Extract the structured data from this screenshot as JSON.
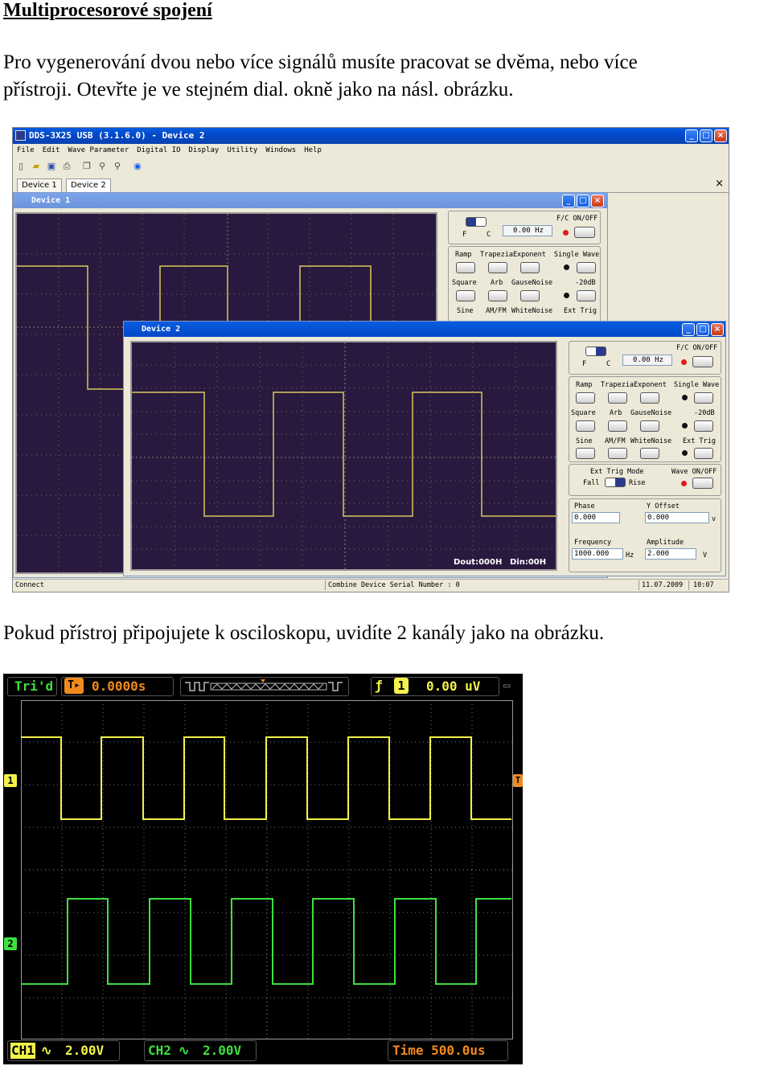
{
  "doc": {
    "title": "Multiprocesorové spojení",
    "para1_line1": "Pro vygenerování dvou nebo více signálů musíte pracovat se dvěma, nebo více",
    "para1_line2": "přístroji. Otevřte je ve stejném dial. okně jako na násl. obrázku.",
    "para2": "Pokud přístroj připojujete k osciloskopu, uvidíte 2 kanály jako na obrázku."
  },
  "app": {
    "title": "DDS-3X25 USB (3.1.6.0) - Device 2",
    "menu": [
      "File",
      "Edit",
      "Wave Parameter",
      "Digital IO",
      "Display",
      "Utility",
      "Windows",
      "Help"
    ],
    "toolbar_icons": [
      "new-icon",
      "open-icon",
      "save-icon",
      "print-icon",
      "copy-icon",
      "zoom-in-icon",
      "zoom-out-icon",
      "help-icon"
    ],
    "tabs": [
      "Device 1",
      "Device 2"
    ],
    "tab_close": "×",
    "device1": {
      "title": "Device 1",
      "fc_label": "F/C ON/OFF",
      "f": "F",
      "c": "C",
      "freq_display": "0.00 Hz",
      "row1": [
        "Ramp",
        "TrapeziaExponent",
        "Single Wave"
      ],
      "row2": [
        "Square",
        "Arb",
        "GauseNoise",
        "-20dB"
      ],
      "row3": [
        "Sine",
        "AM/FM",
        "WhiteNoise",
        "Ext Trig"
      ]
    },
    "device2": {
      "title": "Device 2",
      "fc_label": "F/C ON/OFF",
      "f": "F",
      "c": "C",
      "freq_display": "0.00 Hz",
      "row1": [
        "Ramp",
        "TrapeziaExponent",
        "Single Wave"
      ],
      "row2": [
        "Square",
        "Arb",
        "GauseNoise",
        "-20dB"
      ],
      "row3": [
        "Sine",
        "AM/FM",
        "WhiteNoise",
        "Ext Trig"
      ],
      "ext_trig_mode": "Ext Trig Mode",
      "fall": "Fall",
      "rise": "Rise",
      "wave_onoff": "Wave ON/OFF",
      "phase_label": "Phase",
      "phase_value": "0.000",
      "yoffset_label": "Y Offset",
      "yoffset_value": "0.000",
      "yoffset_unit": "v",
      "frequency_label": "Frequency",
      "frequency_value": "1000.000",
      "frequency_unit": "Hz",
      "amplitude_label": "Amplitude",
      "amplitude_value": "2.000",
      "amplitude_unit": "V",
      "dout": "Dout:000H",
      "din": "Din:00H"
    },
    "status": {
      "connect": "Connect",
      "serial": "Combine Device Serial Number : 0",
      "date": "11.07.2009",
      "time": "10:07"
    }
  },
  "scope": {
    "trig_state": "Tri'd",
    "trig_pos": "0.0000s",
    "trig_level": "0.00 uV",
    "ch1_marker": "1",
    "ch2_marker": "2",
    "trig_marker": "T",
    "ch1_label": "CH1",
    "ch1_scale": "2.00V",
    "ch2_label": "CH2",
    "ch2_scale": "2.00V",
    "timebase": "Time 500.0us",
    "ch1_color": "#f2f24a",
    "ch2_color": "#3ee03e"
  }
}
